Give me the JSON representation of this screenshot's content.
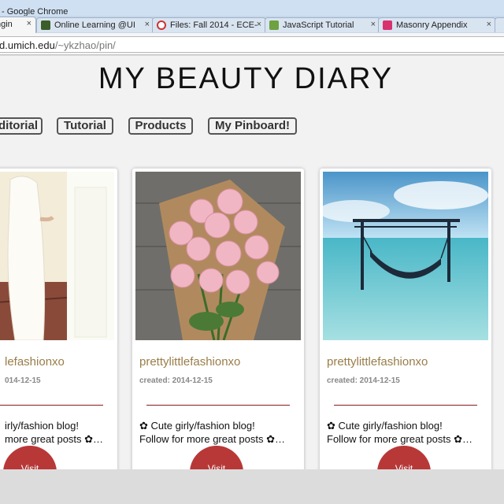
{
  "window": {
    "title": "- Google Chrome"
  },
  "tabs": [
    {
      "label": "ngin",
      "icon": "page-icon",
      "active": true
    },
    {
      "label": "Online Learning @UI",
      "icon": "ctools-icon"
    },
    {
      "label": "Files: Fall 2014 - ECE-",
      "icon": "canvas-icon"
    },
    {
      "label": "JavaScript Tutorial",
      "icon": "w3schools-icon"
    },
    {
      "label": "Masonry Appendix",
      "icon": "masonry-icon"
    }
  ],
  "tab_close_glyph": "×",
  "address": {
    "host": "d.umich.edu",
    "path": "/~ykzhao/pin/"
  },
  "site": {
    "title": "MY BEAUTY DIARY"
  },
  "nav": [
    "ditorial",
    "Tutorial",
    "Products",
    "My Pinboard!"
  ],
  "cards": [
    {
      "user": "lefashionxo",
      "date": "014-12-15",
      "desc1": "irly/fashion blog!",
      "desc2": "more great posts ✿…",
      "visit": "Visit"
    },
    {
      "user": "prettylittlefashionxo",
      "date": "created: 2014-12-15",
      "desc1": "✿ Cute girly/fashion blog!",
      "desc2": "Follow for more great posts ✿…",
      "visit": "Visit"
    },
    {
      "user": "prettylittlefashionxo",
      "date": "created: 2014-12-15",
      "desc1": "✿ Cute girly/fashion blog!",
      "desc2": "Follow for more great posts ✿…",
      "visit": "Visit"
    }
  ],
  "colors": {
    "username": "#9a7d48",
    "visit_button": "#b83838",
    "divider": "#8a1a1a"
  }
}
